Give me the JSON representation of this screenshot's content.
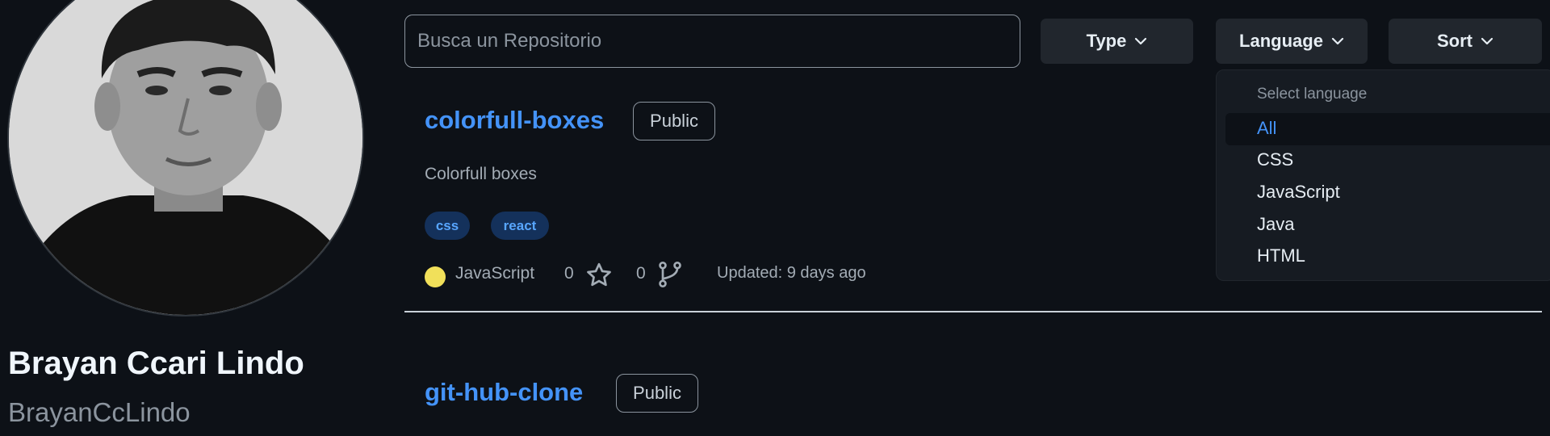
{
  "profile": {
    "name": "Brayan Ccari Lindo",
    "login": "BrayanCcLindo"
  },
  "search": {
    "placeholder": "Busca un Repositorio",
    "value": ""
  },
  "filters": {
    "type_label": "Type",
    "language_label": "Language",
    "sort_label": "Sort"
  },
  "language_dropdown": {
    "header": "Select language",
    "selected": "All",
    "options": [
      "All",
      "CSS",
      "JavaScript",
      "Java",
      "HTML"
    ]
  },
  "repos": [
    {
      "name": "colorfull-boxes",
      "visibility": "Public",
      "description": "Colorfull boxes",
      "topics": [
        "css",
        "react"
      ],
      "language": "JavaScript",
      "language_color": "#f1e05a",
      "stars": "0",
      "forks": "0",
      "updated": "Updated: 9 days ago"
    },
    {
      "name": "git-hub-clone",
      "visibility": "Public"
    }
  ],
  "icons": {
    "star": "star-icon",
    "fork": "fork-icon",
    "dropdown": "chevron-down-icon"
  },
  "colors": {
    "background": "#0d1117",
    "link": "#4493f8",
    "button_bg": "#21262d",
    "dropdown_bg": "#161b22",
    "topic_bg": "#14315b"
  }
}
